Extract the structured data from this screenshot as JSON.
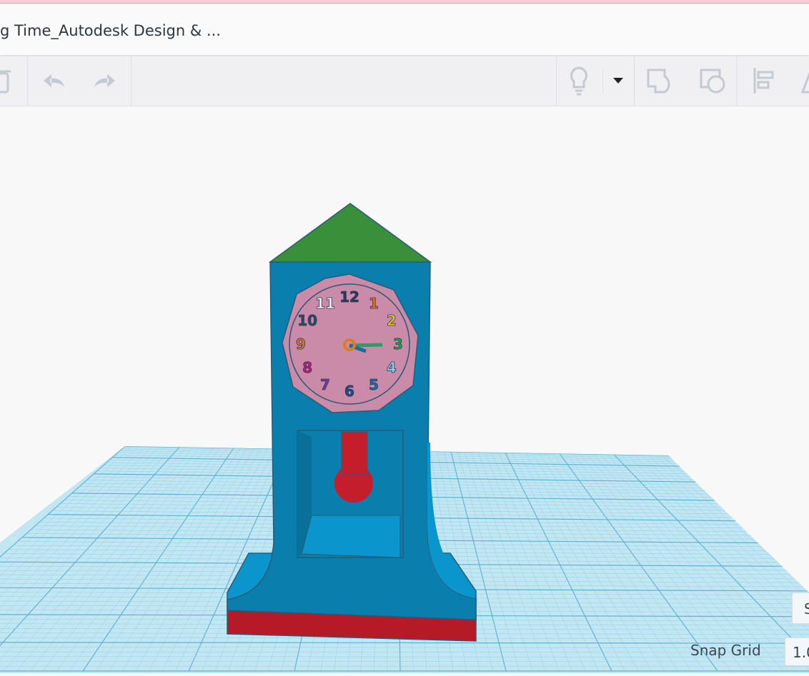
{
  "header": {
    "title": "g Time_Autodesk Design & ..."
  },
  "toolbar": {
    "icons": [
      "trash-icon",
      "undo-icon",
      "redo-icon",
      "lightbulb-icon",
      "dropdown-icon",
      "workplane-icon",
      "ruler-icon",
      "align-icon",
      "mirror-icon"
    ]
  },
  "viewport": {
    "snap_label": "Snap Grid",
    "snap_value": "1.0",
    "settings_label": "S"
  },
  "clock": {
    "numbers": [
      "12",
      "1",
      "2",
      "3",
      "4",
      "5",
      "6",
      "7",
      "8",
      "9",
      "10",
      "11"
    ]
  },
  "colors": {
    "grid": "#a9dcef",
    "roof": "#3a8f3a",
    "body": "#0a7fad",
    "face": "#c98ba8",
    "base": "#b51a26"
  }
}
